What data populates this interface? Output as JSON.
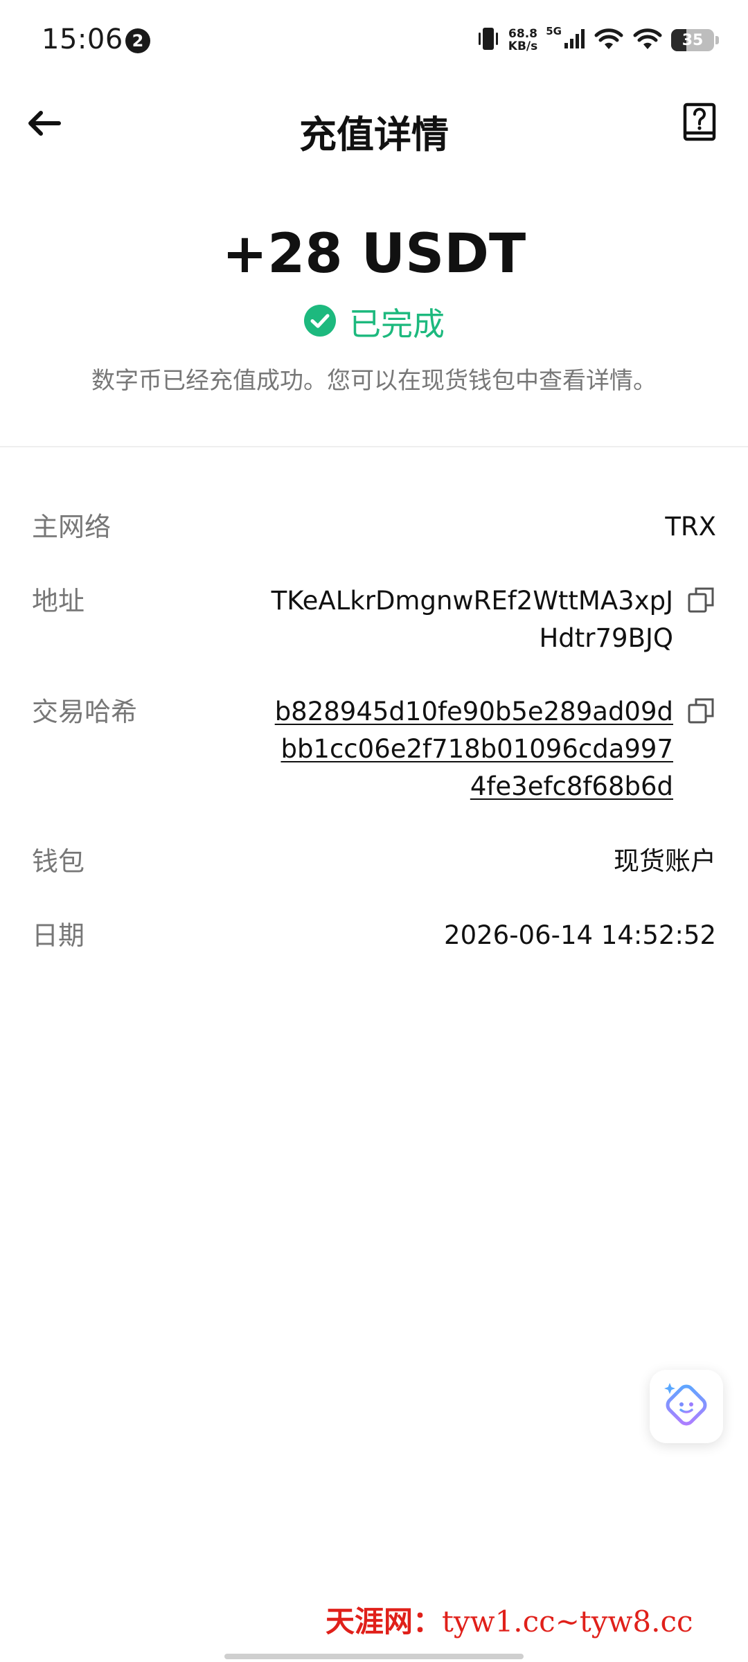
{
  "status_bar": {
    "time": "15:06",
    "notification_count": "2",
    "net_speed_value": "68.8",
    "net_speed_unit": "KB/s",
    "network_type": "5G",
    "battery_level": "35",
    "battery_fraction": 0.35
  },
  "header": {
    "title": "充值详情",
    "back_icon": "arrow-left-icon",
    "help_icon": "question-book-icon"
  },
  "summary": {
    "amount": "+28 USDT",
    "status": "已完成",
    "status_color": "#1db97e",
    "description": "数字币已经充值成功。您可以在现货钱包中查看详情。"
  },
  "details": {
    "network": {
      "label": "主网络",
      "value": "TRX"
    },
    "address": {
      "label": "地址",
      "value": "TKeALkrDmgnwREf2WttMA3xpJHdtr79BJQ"
    },
    "tx_hash": {
      "label": "交易哈希",
      "value": "b828945d10fe90b5e289ad09dbb1cc06e2f718b01096cda9974fe3efc8f68b6d"
    },
    "wallet": {
      "label": "钱包",
      "value": "现货账户"
    },
    "date": {
      "label": "日期",
      "value": "2026-06-14 14:52:52"
    }
  },
  "assistant": {
    "icon": "ai-assistant-face-icon"
  },
  "watermark": {
    "site_name": "天涯网：",
    "urls": "tyw1.cc~tyw8.cc"
  }
}
